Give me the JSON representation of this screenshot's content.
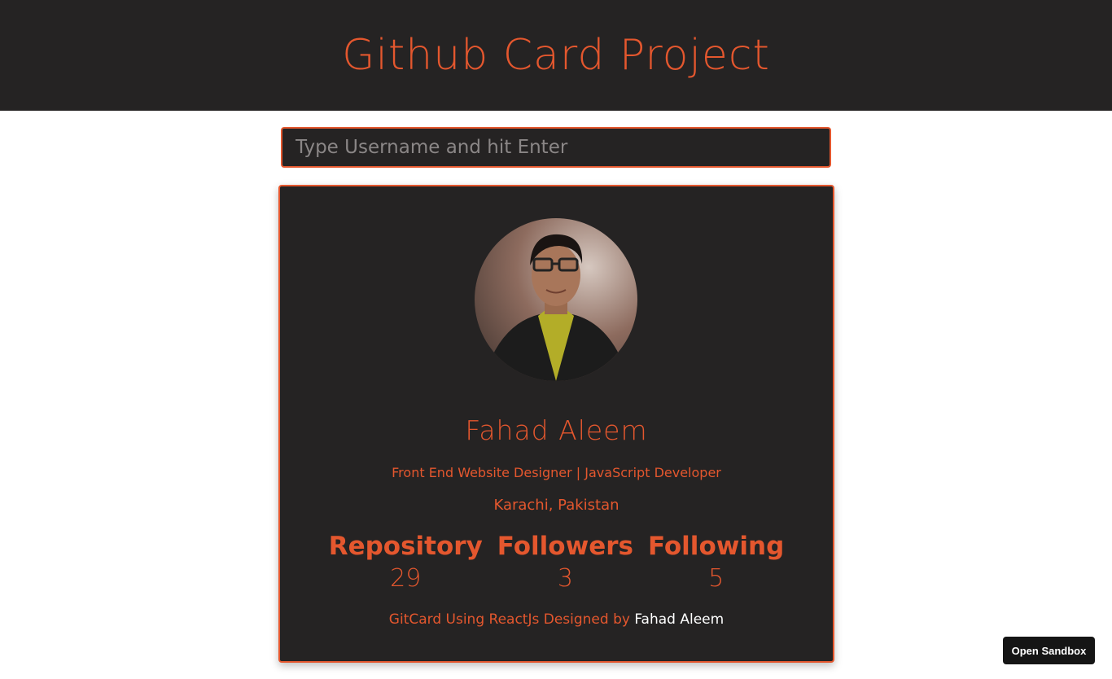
{
  "header": {
    "title": "Github Card Project"
  },
  "search": {
    "placeholder": "Type Username and hit Enter",
    "value": ""
  },
  "profile": {
    "name": "Fahad Aleem",
    "bio": "Front End Website Designer | JavaScript Developer",
    "location": "Karachi, Pakistan",
    "stats": [
      {
        "label": "Repository",
        "value": "29"
      },
      {
        "label": "Followers",
        "value": "3"
      },
      {
        "label": "Following",
        "value": "5"
      }
    ]
  },
  "credit": {
    "prefix": "GitCard Using ReactJs Designed by",
    "author": "Fahad Aleem"
  },
  "sandbox": {
    "label": "Open Sandbox"
  },
  "colors": {
    "accent": "#e4572e",
    "card_bg": "#252323",
    "header_bg": "#252323"
  }
}
